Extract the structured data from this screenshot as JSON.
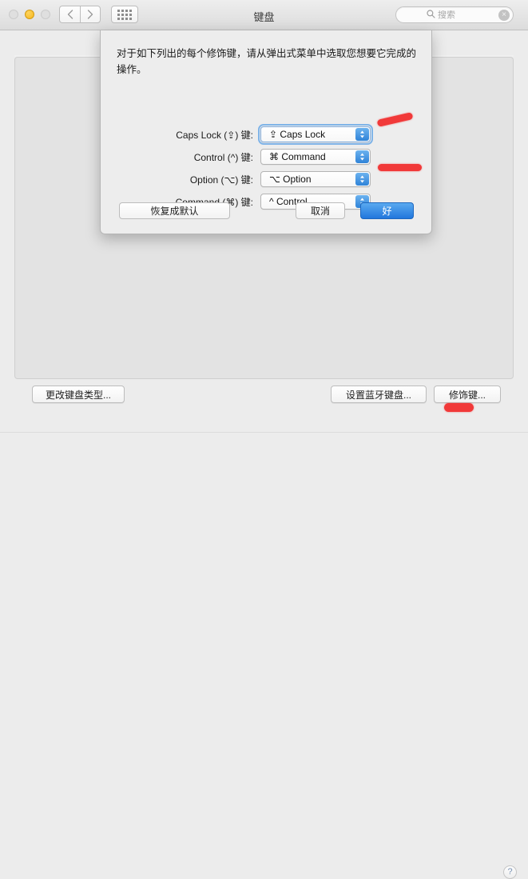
{
  "window": {
    "title": "键盘"
  },
  "toolbar": {
    "back_icon": "chevron-left-icon",
    "forward_icon": "chevron-right-icon",
    "show_all_icon": "grid-icon",
    "search": {
      "placeholder": "搜索",
      "value": "",
      "icon": "search-icon",
      "clear_icon": "×"
    }
  },
  "sheet": {
    "message": "对于如下列出的每个修饰键，请从弹出式菜单中选取您想要它完成的操作。",
    "rows": [
      {
        "label": "Caps Lock (⇪) 键:",
        "value": "⇪ Caps Lock",
        "focused": true
      },
      {
        "label": "Control (^) 键:",
        "value": "⌘ Command",
        "focused": false
      },
      {
        "label": "Option (⌥) 键:",
        "value": "⌥ Option",
        "focused": false
      },
      {
        "label": "Command (⌘) 键:",
        "value": "^ Control",
        "focused": false
      }
    ],
    "restore_defaults_label": "恢复成默认",
    "cancel_label": "取消",
    "ok_label": "好"
  },
  "pane": {
    "change_keyboard_type_label": "更改键盘类型...",
    "setup_bluetooth_keyboard_label": "设置蓝牙键盘...",
    "modifier_keys_label": "修饰键...",
    "help_label": "?"
  },
  "colors": {
    "accent_blue": "#2277dd",
    "popup_arrow_blue": "#2f83d8",
    "marker_red": "#f22a2a",
    "minimize_yellow": "#f7b81e",
    "window_bg": "#ececec"
  },
  "annotations": [
    {
      "name": "marker-control-row",
      "shape": "diagonal-stroke"
    },
    {
      "name": "marker-command-row",
      "shape": "horizontal-stroke"
    },
    {
      "name": "marker-modifier-keys",
      "shape": "horizontal-stroke"
    }
  ]
}
